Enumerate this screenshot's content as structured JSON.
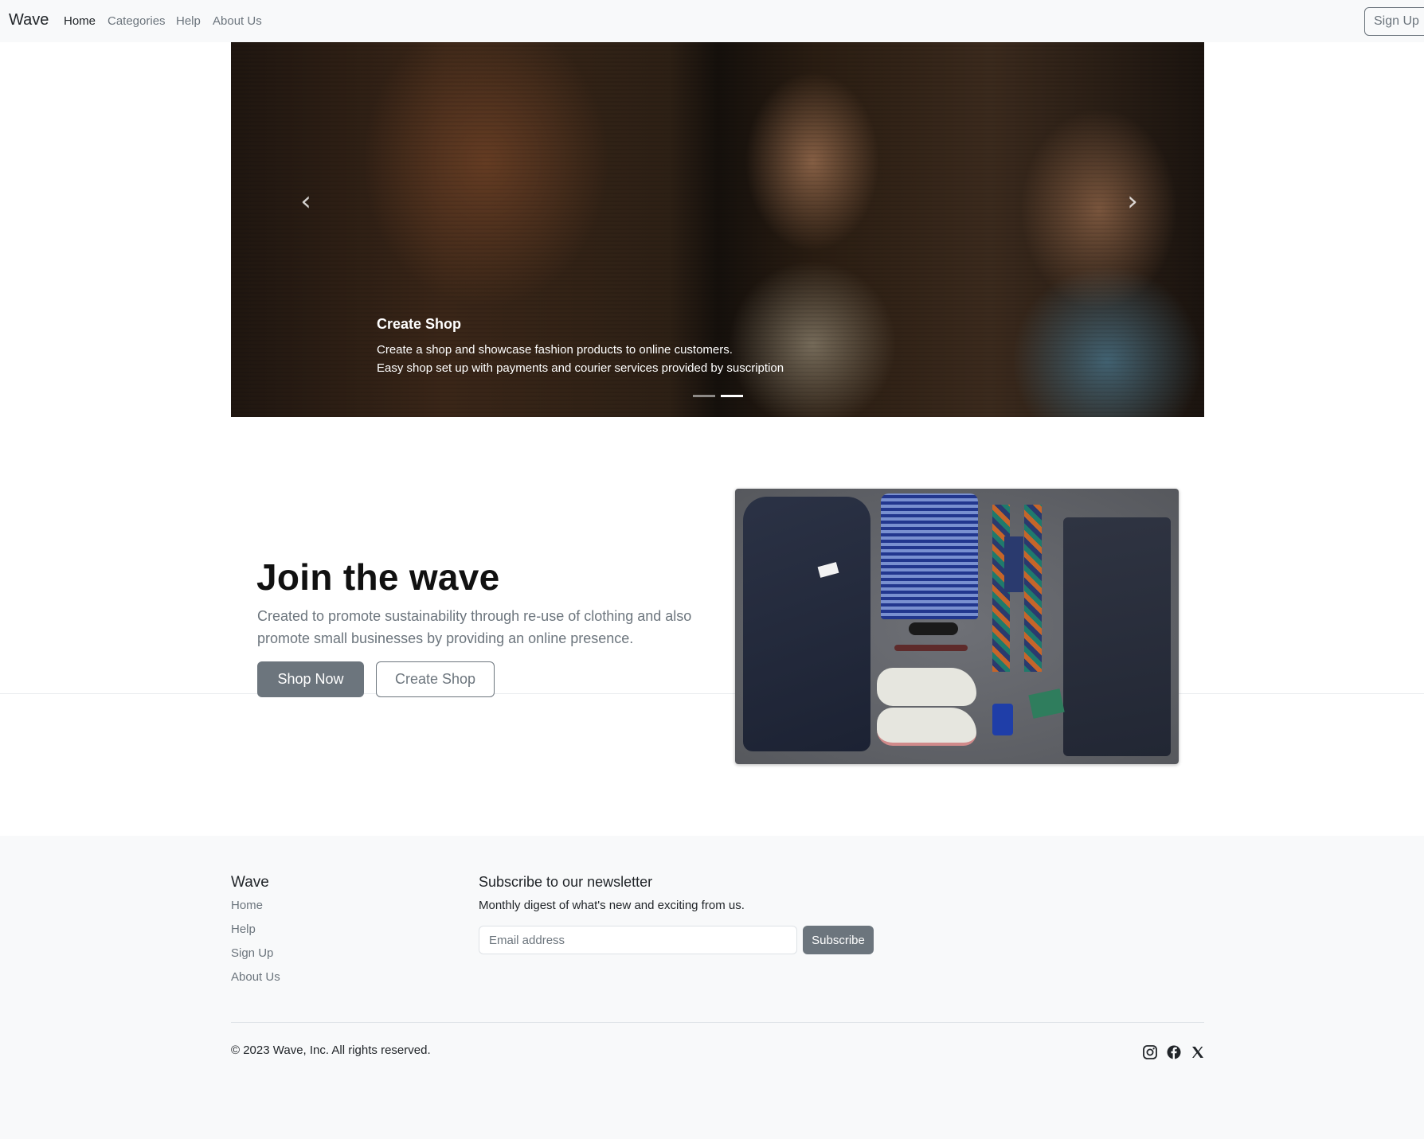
{
  "navbar": {
    "brand": "Wave",
    "links": [
      "Home",
      "Categories",
      "Help",
      "About Us"
    ],
    "signup": "Sign Up"
  },
  "carousel": {
    "caption_title": "Create Shop",
    "caption_line1": "Create a shop and showcase fashion products to online customers.",
    "caption_line2": "Easy shop set up with payments and courier services provided by suscription",
    "prev_icon": "chevron-left-icon",
    "next_icon": "chevron-right-icon",
    "slides": 2,
    "active_slide": 2
  },
  "hero": {
    "title": "Join the wave",
    "text": "Created to promote sustainability through re-use of clothing and also promote small businesses by providing an online presence.",
    "primary_button": "Shop Now",
    "secondary_button": "Create Shop"
  },
  "footer": {
    "brand": "Wave",
    "links": [
      "Home",
      "Help",
      "Sign Up",
      "About Us"
    ],
    "newsletter_title": "Subscribe to our newsletter",
    "newsletter_sub": "Monthly digest of what's new and exciting from us.",
    "email_placeholder": "Email address",
    "subscribe_button": "Subscribe",
    "copyright": "© 2023 Wave, Inc. All rights reserved.",
    "social_icons": [
      "instagram-icon",
      "facebook-icon",
      "x-twitter-icon"
    ]
  },
  "colors": {
    "navbar_bg": "#f8f9fa",
    "secondary": "#6c757d",
    "text": "#212529"
  }
}
